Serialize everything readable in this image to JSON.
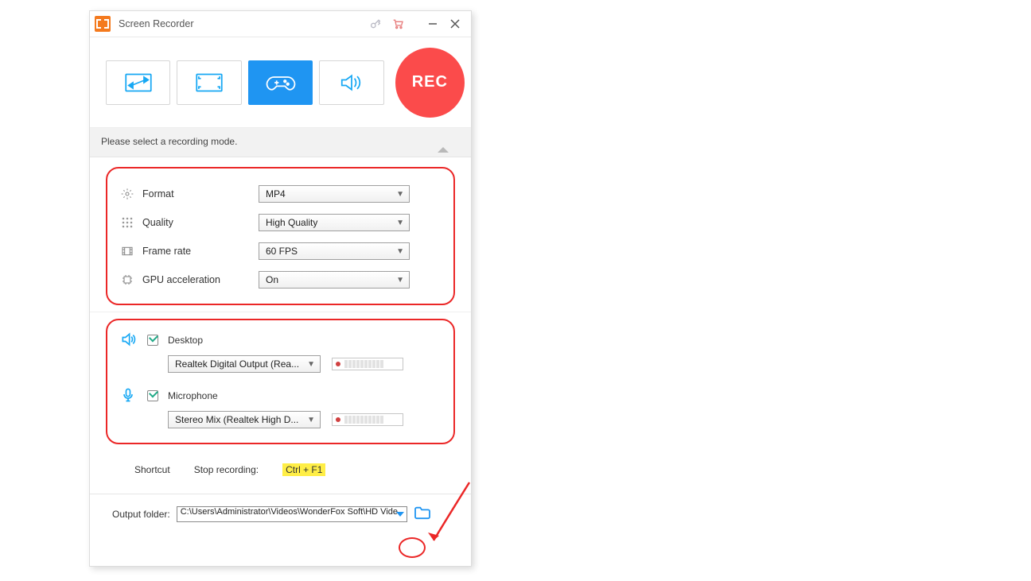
{
  "titlebar": {
    "title": "Screen Recorder"
  },
  "rec": {
    "label": "REC"
  },
  "hint": {
    "text": "Please select a recording mode."
  },
  "settings": {
    "format": {
      "label": "Format",
      "value": "MP4"
    },
    "quality": {
      "label": "Quality",
      "value": "High Quality"
    },
    "framerate": {
      "label": "Frame rate",
      "value": "60 FPS"
    },
    "gpu": {
      "label": "GPU acceleration",
      "value": "On"
    }
  },
  "audio": {
    "desktop": {
      "label": "Desktop",
      "device": "Realtek Digital Output (Rea..."
    },
    "mic": {
      "label": "Microphone",
      "device": "Stereo Mix (Realtek High D..."
    }
  },
  "shortcut": {
    "label": "Shortcut",
    "stop_label": "Stop recording:",
    "stop_key": "Ctrl + F1"
  },
  "footer": {
    "label": "Output folder:",
    "path": "C:\\Users\\Administrator\\Videos\\WonderFox Soft\\HD Vide"
  }
}
